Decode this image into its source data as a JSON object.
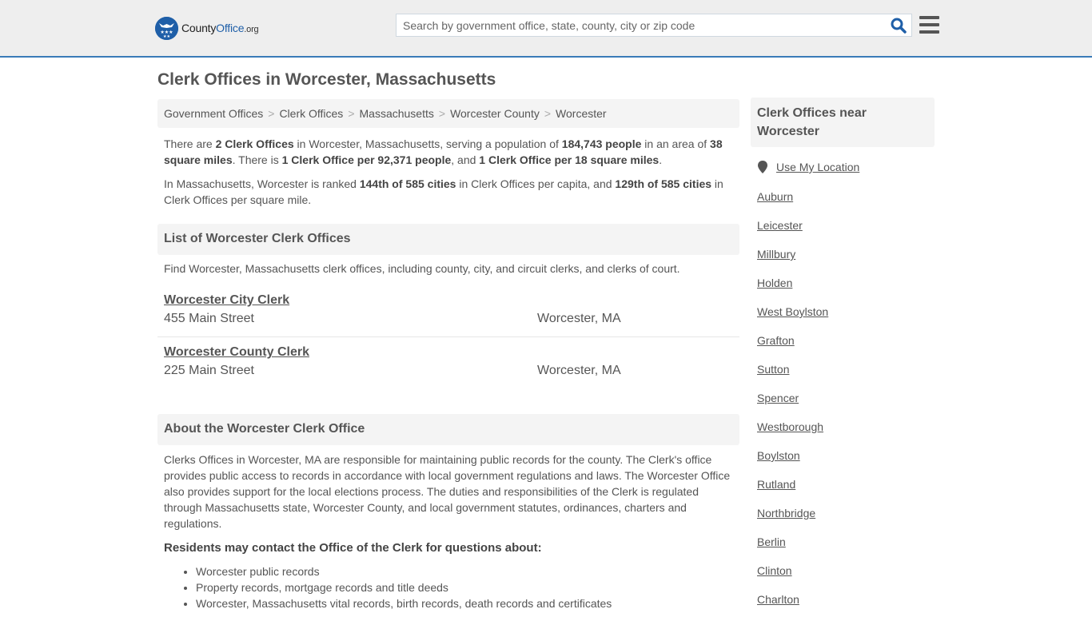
{
  "header": {
    "logo": {
      "prefix": "County",
      "brand": "Office",
      "tld": ".org"
    },
    "search": {
      "placeholder": "Search by government office, state, county, city or zip code",
      "value": ""
    },
    "colors": {
      "brand": "#1f5fa8",
      "header_bg": "#eeeeee",
      "accent_line": "#3a7bb8"
    }
  },
  "page": {
    "title": "Clerk Offices in Worcester, Massachusetts"
  },
  "breadcrumb": [
    {
      "label": "Government Offices"
    },
    {
      "label": "Clerk Offices"
    },
    {
      "label": "Massachusetts"
    },
    {
      "label": "Worcester County"
    },
    {
      "label": "Worcester"
    }
  ],
  "summary": {
    "p1": {
      "t1": "There are ",
      "b1": "2 Clerk Offices",
      "t2": " in Worcester, Massachusetts, serving a population of ",
      "b2": "184,743 people",
      "t3": " in an area of ",
      "b3": "38 square miles",
      "t4": ". There is ",
      "b4": "1 Clerk Office per 92,371 people",
      "t5": ", and ",
      "b5": "1 Clerk Office per 18 square miles",
      "t6": "."
    },
    "p2": {
      "t1": "In Massachusetts, Worcester is ranked ",
      "b1": "144th of 585 cities",
      "t2": " in Clerk Offices per capita, and ",
      "b2": "129th of 585 cities",
      "t3": " in Clerk Offices per square mile."
    }
  },
  "list_section": {
    "heading": "List of Worcester Clerk Offices",
    "description": "Find Worcester, Massachusetts clerk offices, including county, city, and circuit clerks, and clerks of court.",
    "offices": [
      {
        "name": "Worcester City Clerk",
        "address": "455 Main Street",
        "city": "Worcester, MA"
      },
      {
        "name": "Worcester County Clerk",
        "address": "225 Main Street",
        "city": "Worcester, MA"
      }
    ]
  },
  "about_section": {
    "heading": "About the Worcester Clerk Office",
    "body": "Clerks Offices in Worcester, MA are responsible for maintaining public records for the county. The Clerk's office provides public access to records in accordance with local government regulations and laws. The Worcester Office also provides support for the local elections process. The duties and responsibilities of the Clerk is regulated through Massachusetts state, Worcester County, and local government statutes, ordinances, charters and regulations.",
    "residents_heading": "Residents may contact the Office of the Clerk for questions about:",
    "topics": [
      "Worcester public records",
      "Property records, mortgage records and title deeds",
      "Worcester, Massachusetts vital records, birth records, death records and certificates"
    ]
  },
  "sidebar": {
    "heading": "Clerk Offices near Worcester",
    "use_location": "Use My Location",
    "nearby": [
      "Auburn",
      "Leicester",
      "Millbury",
      "Holden",
      "West Boylston",
      "Grafton",
      "Sutton",
      "Spencer",
      "Westborough",
      "Boylston",
      "Rutland",
      "Northbridge",
      "Berlin",
      "Clinton",
      "Charlton"
    ]
  }
}
